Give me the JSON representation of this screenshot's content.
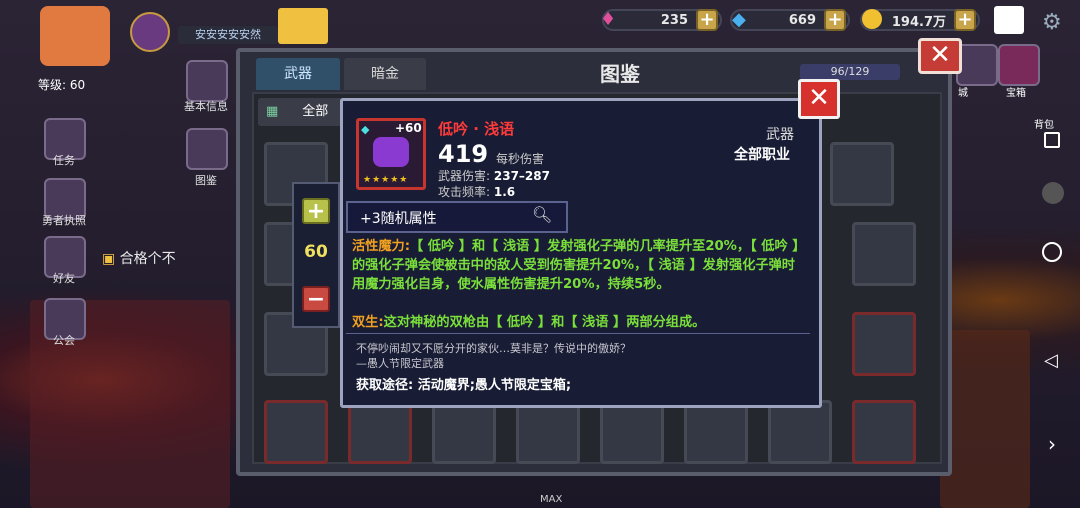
{
  "player": {
    "name": "安安安安安然",
    "level_label": "等级: 60"
  },
  "resources": {
    "gems": "235",
    "diamonds": "669",
    "coins": "194.7万",
    "plus_label": "+"
  },
  "left_menu": [
    {
      "label": "基本信息"
    },
    {
      "label": "任务"
    },
    {
      "label": "图鉴"
    },
    {
      "label": "勇者执照"
    },
    {
      "label": "好友"
    },
    {
      "label": "公会"
    }
  ],
  "chat_hint": "合格个不",
  "right_menu": [
    {
      "label": "城"
    },
    {
      "label": "宝箱"
    },
    {
      "label": "背包"
    }
  ],
  "codex": {
    "title": "图鉴",
    "tabs": [
      "武器",
      "暗金"
    ],
    "count": "96/129",
    "filters": [
      "全部",
      "全部",
      "全部"
    ],
    "max_label": "MAX"
  },
  "stepper": {
    "plus": "+",
    "minus": "−",
    "value": "60"
  },
  "weapon": {
    "name": "低吟 · 浅语",
    "upgrade": "+60",
    "stars": "★★★★★",
    "dps": "419",
    "dps_label": "每秒伤害",
    "damage_label": "武器伤害:",
    "damage": "237–287",
    "rate_label": "攻击频率:",
    "rate": "1.6",
    "type": "武器",
    "class": "全部职业",
    "random_attr": "+3随机属性",
    "skill1_name": "活性魔力:",
    "skill1_text": "【 低吟 】和【 浅语 】发射强化子弹的几率提升至20%，【 低吟 】的强化子弹会使被击中的敌人受到伤害提升20%，【 浅语 】发射强化子弹时用魔力强化自身，使水属性伤害提升20%，持续5秒。",
    "skill2_name": "双生:",
    "skill2_text": "这对神秘的双枪由【 低吟 】和【 浅语 】两部分组成。",
    "flavor_line1": "不停吵闹却又不愿分开的家伙…莫非是？传说中的傲娇？",
    "flavor_line2": "—愚人节限定武器",
    "obtain_label": "获取途径:",
    "obtain": "活动魔界;愚人节限定宝箱;"
  },
  "colors": {
    "accent_red": "#d6312c",
    "skill_orange": "#f0a020",
    "skill_green": "#7adf3a",
    "popup_bg": "#181c34"
  }
}
